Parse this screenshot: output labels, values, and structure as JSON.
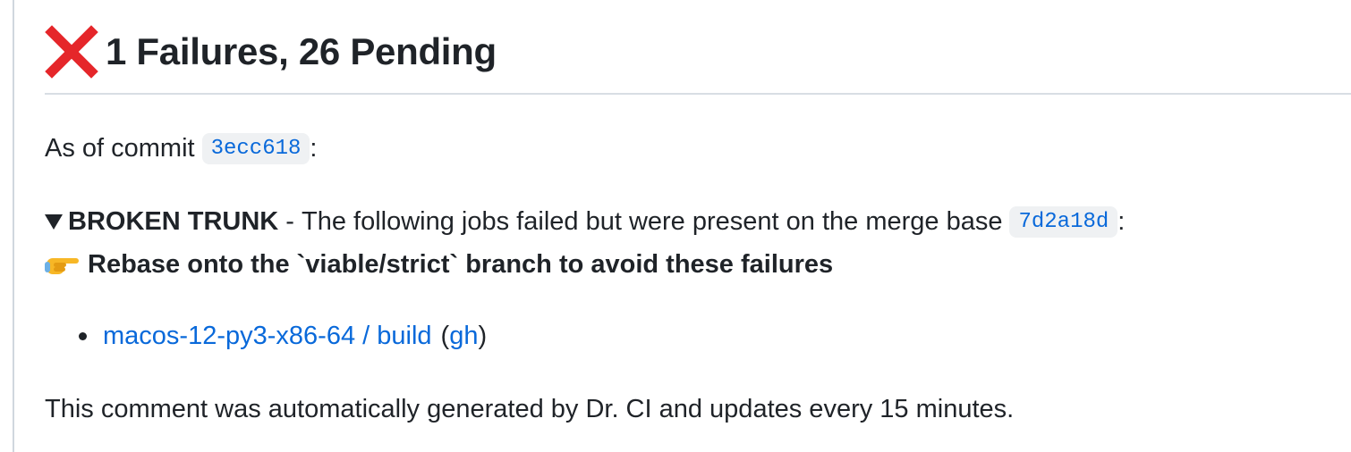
{
  "comment": {
    "heading": {
      "icon": "red-cross-mark-icon",
      "text": "1 Failures, 26 Pending"
    },
    "commit_line": {
      "prefix": "As of commit",
      "commit": "3ecc618",
      "suffix": ":"
    },
    "broken_trunk": {
      "toggle_icon": "triangle-down-icon",
      "title": "BROKEN TRUNK",
      "separator": " - ",
      "description": "The following jobs failed but were present on the merge base",
      "merge_base": "7d2a18d",
      "suffix": ":"
    },
    "rebase_note": {
      "icon": "pointing-right-hand-icon",
      "text": "Rebase onto the `viable/strict` branch to avoid these failures"
    },
    "failed_jobs": [
      {
        "name": "macos-12-py3-x86-64 / build",
        "open_paren": "(",
        "link_label": "gh",
        "close_paren": ")"
      }
    ],
    "footer": "This comment was automatically generated by Dr. CI and updates every 15 minutes."
  },
  "colors": {
    "text": "#1f2328",
    "link": "#0969da",
    "code_background": "#eff1f3",
    "cross": "#e5262a",
    "rule": "#d8dee4"
  }
}
